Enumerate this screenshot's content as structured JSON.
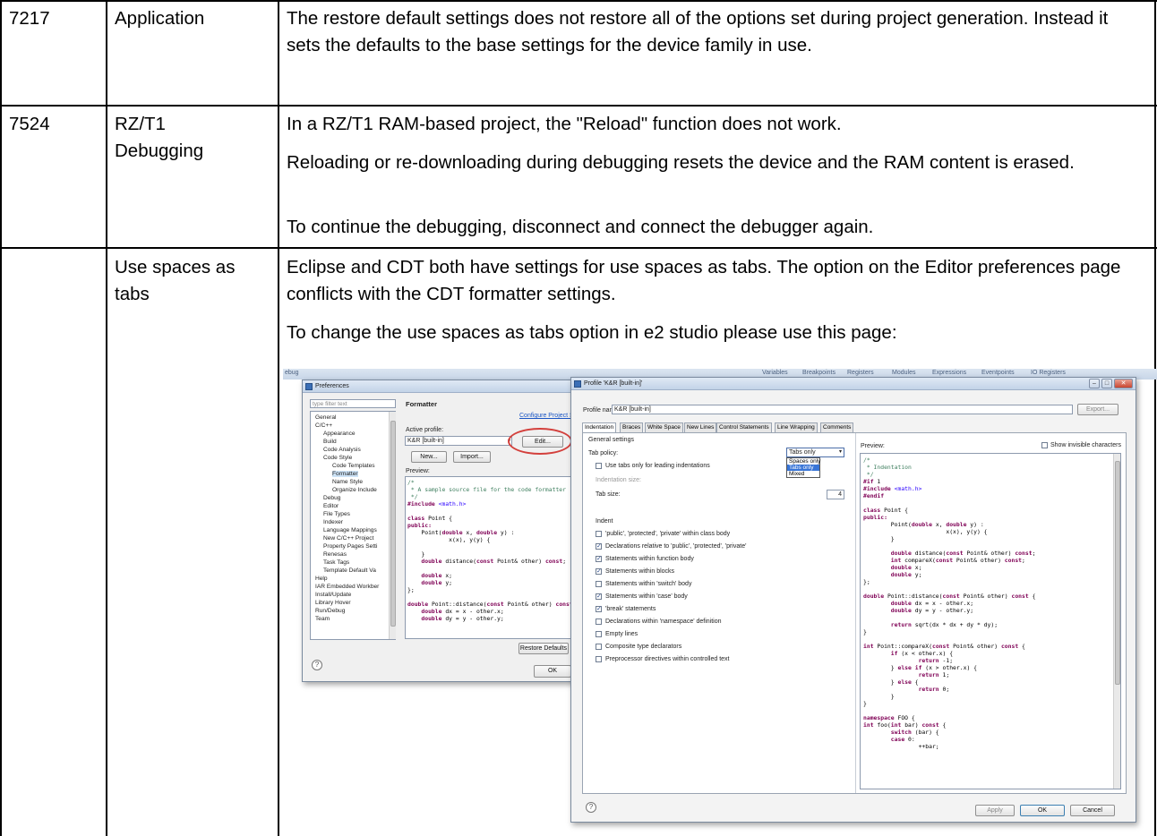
{
  "rows": [
    {
      "id": "7217",
      "component": "Application",
      "description": "The restore default settings does not restore all of the options set during project generation.  Instead it sets the defaults to the base settings for the device family in use."
    },
    {
      "id": "7524",
      "component": "RZ/T1 Debugging",
      "paragraphs": [
        "In a RZ/T1 RAM-based project, the \"Reload\" function does not work.",
        "Reloading or re-downloading during debugging resets the device and the RAM content is erased.",
        "To continue the debugging, disconnect and connect the debugger again."
      ]
    },
    {
      "id": "",
      "component": "Use spaces as tabs",
      "paragraphs": [
        "Eclipse and CDT both have settings for use spaces as tabs. The option on the Editor preferences page conflicts with the CDT formatter settings.",
        "To change the use spaces as tabs option in e2 studio please use this page:"
      ]
    }
  ],
  "screenshot": {
    "bg_toolbar": {
      "left_label": "ebug",
      "views": [
        "Variables",
        "Breakpoints",
        "Registers",
        "Modules",
        "Expressions",
        "Eventpoints",
        "IO Registers"
      ]
    },
    "preferences": {
      "title": "Preferences",
      "filter_placeholder": "type filter text",
      "tree": [
        "General",
        "C/C++",
        "Appearance",
        "Build",
        "Code Analysis",
        "Code Style",
        "Code Templates",
        "Formatter",
        "Name Style",
        "Organize Include",
        "Debug",
        "Editor",
        "File Types",
        "Indexer",
        "Language Mappings",
        "New C/C++ Project",
        "Property Pages Setti",
        "Renesas",
        "Task Tags",
        "Template Default Va",
        "Help",
        "IAR Embedded Workber",
        "Install/Update",
        "Library Hover",
        "Run/Debug",
        "Team"
      ],
      "page_title": "Formatter",
      "configure_link": "Configure Project S",
      "active_profile_label": "Active profile:",
      "active_profile_value": "K&R [built-in]",
      "edit_button": "Edit...",
      "new_button": "New...",
      "import_button": "Import...",
      "preview_label": "Preview:",
      "restore_button": "Restore Defaults",
      "ok_button": "OK"
    },
    "profile": {
      "title": "Profile 'K&R [built-in]'",
      "profile_name_label": "Profile name:",
      "profile_name_value": "K&R [built-in]",
      "export_button": "Export...",
      "tabs": [
        "Indentation",
        "Braces",
        "White Space",
        "New Lines",
        "Control Statements",
        "Line Wrapping",
        "Comments"
      ],
      "general_settings": "General settings",
      "tab_policy_label": "Tab policy:",
      "tab_policy_value": "Tabs only",
      "tab_policy_options": [
        "Spaces only",
        "Tabs only",
        "Mixed"
      ],
      "use_tabs_leading": "Use tabs only for leading indentations",
      "indentation_size_label": "Indentation size:",
      "tab_size_label": "Tab size:",
      "tab_size_value": "4",
      "indent_group": "Indent",
      "indent_options": [
        {
          "label": "'public', 'protected', 'private' within class body",
          "checked": false
        },
        {
          "label": "Declarations relative to 'public', 'protected', 'private'",
          "checked": true
        },
        {
          "label": "Statements within function body",
          "checked": true
        },
        {
          "label": "Statements within blocks",
          "checked": true
        },
        {
          "label": "Statements within 'switch' body",
          "checked": false
        },
        {
          "label": "Statements within 'case' body",
          "checked": true
        },
        {
          "label": "'break' statements",
          "checked": true
        },
        {
          "label": "Declarations within 'namespace' definition",
          "checked": false
        },
        {
          "label": "Empty lines",
          "checked": false
        },
        {
          "label": "Composite type declarators",
          "checked": false
        },
        {
          "label": "Preprocessor directives within controlled text",
          "checked": false
        }
      ],
      "preview_label": "Preview:",
      "show_invisible": "Show invisible characters",
      "apply_button": "Apply",
      "ok_button": "OK",
      "cancel_button": "Cancel"
    }
  }
}
